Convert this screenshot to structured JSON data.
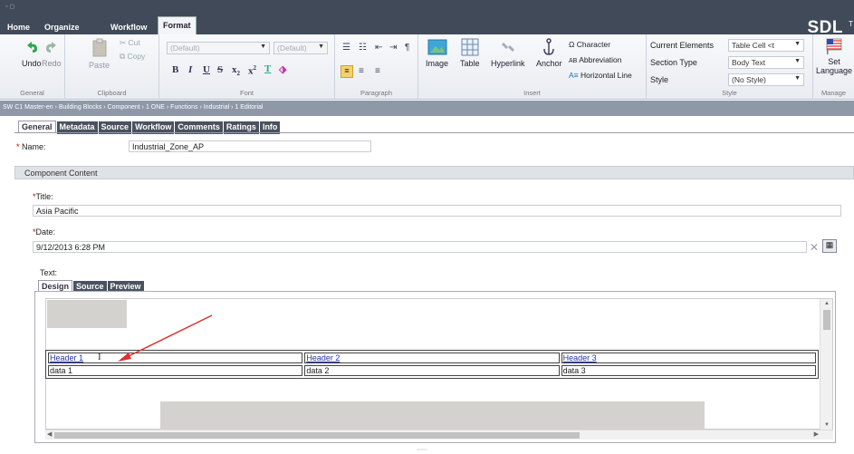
{
  "ribbon": {
    "tabs": [
      "Home",
      "Organize",
      "Workflow",
      "Format"
    ],
    "brand": "SDL",
    "brand_suffix": "T",
    "general": {
      "label": "General",
      "undo": "Undo",
      "redo": "Redo"
    },
    "clipboard": {
      "label": "Clipboard",
      "paste": "Paste",
      "cut": "Cut",
      "copy": "Copy"
    },
    "font": {
      "label": "Font",
      "family": "(Default)",
      "size": "(Default)"
    },
    "paragraph": {
      "label": "Paragraph"
    },
    "insert": {
      "label": "Insert",
      "image": "Image",
      "table": "Table",
      "hyperlink": "Hyperlink",
      "anchor": "Anchor",
      "character": "Character",
      "abbreviation": "Abbreviation",
      "horizontal_line": "Horizontal Line"
    },
    "style": {
      "label": "Style",
      "current_elements_label": "Current Elements",
      "current_elements_value": "Table Cell <t",
      "section_type_label": "Section Type",
      "section_type_value": "Body Text",
      "style_label": "Style",
      "style_value": "(No Style)"
    },
    "manage": {
      "label": "Manage",
      "set_language": "Set Language"
    }
  },
  "breadcrumb": "SW C1 Master-en › Building Blocks › Component › 1 ONE › Functions › Industrial › 1 Editorial",
  "tabs": [
    "General",
    "Metadata",
    "Source",
    "Workflow",
    "Comments",
    "Ratings",
    "Info"
  ],
  "name": {
    "label": "Name:",
    "value": "Industrial_Zone_AP"
  },
  "section_title": "Component Content",
  "title_field": {
    "label": "Title:",
    "value": "Asia Pacific"
  },
  "date_field": {
    "label": "Date:",
    "value": "9/12/2013 6:28 PM"
  },
  "text_field": {
    "label": "Text:"
  },
  "editor_tabs": [
    "Design",
    "Source",
    "Preview"
  ],
  "table": {
    "headers": [
      "Header 1",
      "Header 2",
      "Header 3"
    ],
    "rows": [
      [
        "data 1",
        "data 2",
        "data 3"
      ]
    ]
  },
  "colors": {
    "ribbon_dark": "#404a58",
    "breadcrumb": "#8e98a7",
    "annotation": "#e03030"
  }
}
